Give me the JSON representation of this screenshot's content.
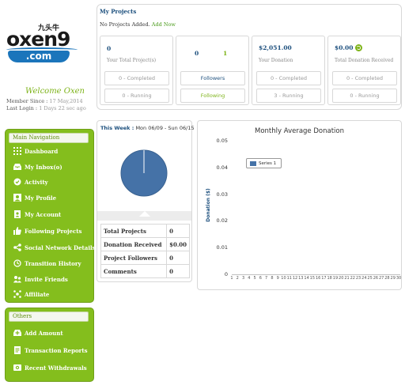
{
  "logo": {
    "brand": "oxen9",
    "chinese": "九头牛",
    "domain": ".com"
  },
  "welcome": "Welcome Oxen",
  "member_since": {
    "label": "Member Since :",
    "value": "17 May,2014"
  },
  "last_login": {
    "label": "Last Login :",
    "value": "1 Days 22 sec ago"
  },
  "main_nav": {
    "title": "Main Navigation",
    "items": [
      {
        "label": "Dashboard",
        "icon": "dashboard-icon"
      },
      {
        "label": "My Inbox(o)",
        "icon": "inbox-icon"
      },
      {
        "label": "Activity",
        "icon": "activity-icon"
      },
      {
        "label": "My Profile",
        "icon": "profile-icon"
      },
      {
        "label": "My Account",
        "icon": "account-icon"
      },
      {
        "label": "Following Projects",
        "icon": "thumbs-up-icon"
      },
      {
        "label": "Social Network Details",
        "icon": "social-icon"
      },
      {
        "label": "Transition History",
        "icon": "history-icon"
      },
      {
        "label": "Invite Friends",
        "icon": "invite-friends-icon"
      },
      {
        "label": "Affiliate",
        "icon": "affiliate-icon"
      }
    ]
  },
  "others_nav": {
    "title": "Others",
    "items": [
      {
        "label": "Add Amount",
        "icon": "add-amount-icon"
      },
      {
        "label": "Transaction Reports",
        "icon": "report-icon"
      },
      {
        "label": "Recent Withdrawals",
        "icon": "withdrawal-icon"
      }
    ]
  },
  "projects": {
    "title": "My Projects",
    "empty_text": "No Projects Added.",
    "add_link": "Add Now"
  },
  "cards": [
    {
      "value": "0",
      "label": "Your Total Project(s)",
      "box1": "0 - Completed",
      "box2": "0 - Running"
    },
    {
      "value_left": "0",
      "value_right": "1",
      "box1": "Followers",
      "box2": "Following"
    },
    {
      "value": "$2,051.00",
      "label": "Your Donation",
      "box1": "0 - Completed",
      "box2": "3 - Running"
    },
    {
      "value": "$0.00",
      "label": "Total Donation Received",
      "box1": "0 - Completed",
      "box2": "0 - Running"
    }
  ],
  "week": {
    "label": "This Week :",
    "range": "Mon 06/09 - Sun 06/15"
  },
  "stats": [
    {
      "label": "Total Projects",
      "value": "0"
    },
    {
      "label": "Donation Received",
      "value": "$0.00"
    },
    {
      "label": "Project Followers",
      "value": "0"
    },
    {
      "label": "Comments",
      "value": "0"
    }
  ],
  "colors": {
    "accent_green": "#84be1d",
    "brand_blue": "#1b75bb",
    "series_blue": "#4572a7"
  },
  "chart_data": {
    "type": "line",
    "title": "Monthly Average Donation",
    "ylabel": "Donation ($)",
    "xlabel": "",
    "ylim": [
      0,
      0.05
    ],
    "y_ticks": [
      "0",
      "0.01",
      "0.02",
      "0.03",
      "0.04",
      "0.05"
    ],
    "x": [
      "1",
      "2",
      "3",
      "4",
      "5",
      "6",
      "7",
      "8",
      "9",
      "10",
      "11",
      "12",
      "13",
      "14",
      "15",
      "16",
      "17",
      "18",
      "19",
      "20",
      "21",
      "22",
      "23",
      "24",
      "25",
      "26",
      "27",
      "28",
      "29",
      "30"
    ],
    "series": [
      {
        "name": "Series 1",
        "values": []
      }
    ],
    "legend": "top-left",
    "grid": false
  }
}
